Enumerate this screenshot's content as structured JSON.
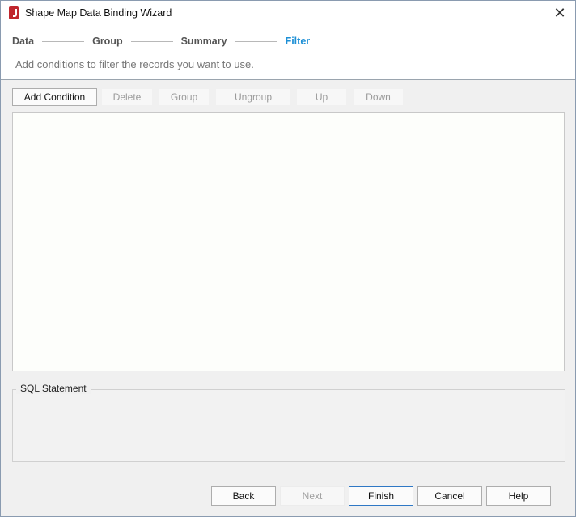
{
  "window": {
    "title": "Shape Map Data Binding Wizard",
    "close_glyph": "✕",
    "icon": "jreport-app-icon"
  },
  "steps": [
    {
      "label": "Data",
      "active": false
    },
    {
      "label": "Group",
      "active": false
    },
    {
      "label": "Summary",
      "active": false
    },
    {
      "label": "Filter",
      "active": true
    }
  ],
  "hint": "Add conditions to filter the records you want to use.",
  "toolbar": {
    "add_condition": "Add Condition",
    "delete": "Delete",
    "group": "Group",
    "ungroup": "Ungroup",
    "up": "Up",
    "down": "Down"
  },
  "sql": {
    "legend": "SQL Statement"
  },
  "footer": {
    "back": "Back",
    "next": "Next",
    "finish": "Finish",
    "cancel": "Cancel",
    "help": "Help"
  },
  "colors": {
    "active_step": "#1e90d6",
    "default_button_border": "#2f78c5",
    "app_icon": "#c0262d"
  }
}
